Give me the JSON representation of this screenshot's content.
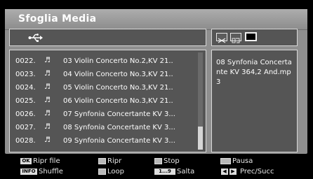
{
  "window": {
    "title": "Sfoglia Media"
  },
  "source": {
    "icon": "usb-icon"
  },
  "view_icons": [
    "list-view-icon",
    "thumbnail-view-icon",
    "black-screen-icon"
  ],
  "file_list": {
    "rows": [
      {
        "index": "0022.",
        "icon": "music-note-icon",
        "name": "03 Violin Concerto No.2,KV 21.."
      },
      {
        "index": "0023.",
        "icon": "music-note-icon",
        "name": "04 Violin Concerto No.3,KV 21.."
      },
      {
        "index": "0024.",
        "icon": "music-note-icon",
        "name": "05 Violin Concerto No.3,KV 21.."
      },
      {
        "index": "0025.",
        "icon": "music-note-icon",
        "name": "06 Violin Concerto No.3,KV 21.."
      },
      {
        "index": "0026.",
        "icon": "music-note-icon",
        "name": "07 Synfonia Concertante KV 3..."
      },
      {
        "index": "0027.",
        "icon": "music-note-icon",
        "name": "08 Synfonia Concertante KV 3..."
      },
      {
        "index": "0028.",
        "icon": "music-note-icon",
        "name": "09 Synfonia Concertante KV 3..."
      }
    ]
  },
  "info_panel": {
    "filename": "08 Synfonia Concertante KV 364,2 And.mp3"
  },
  "legend": {
    "ok_key": "OK",
    "ripr_file": "Ripr file",
    "info_key": "INFO",
    "shuffle": "Shuffle",
    "ripr": "Ripr",
    "loop": "Loop",
    "stop": "Stop",
    "num_key": "1...9",
    "salta": "Salta",
    "pausa": "Pausa",
    "prec_succ": "Prec/Succ"
  },
  "colors": {
    "panel": "#8f8f8f",
    "box": "#555555",
    "text": "#ffffff"
  }
}
